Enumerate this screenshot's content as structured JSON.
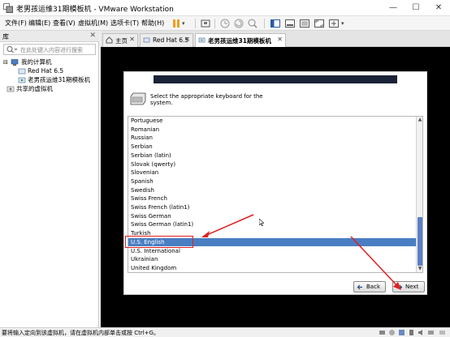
{
  "window": {
    "title": "老男孩运维31期模板机 - VMware Workstation",
    "minimize": "—",
    "maximize": "☐",
    "close": "✕",
    "accent": "#4a7ec3"
  },
  "menu": {
    "file": "文件(F)",
    "edit": "编辑(E)",
    "view": "查看(V)",
    "vm": "虚拟机(M)",
    "tabs": "选项卡(T)",
    "help": "帮助(H)"
  },
  "library": {
    "title": "库",
    "close": "✕",
    "search_placeholder": "在此处键入内容进行搜索",
    "my_computer": "我的计算机",
    "vm1": "Red Hat 6.5",
    "vm2": "老男孩运维31期模板机",
    "shared": "共享的虚拟机"
  },
  "tabs": {
    "home": "主页",
    "redhat": "Red Hat 6.5",
    "active": "老男孩运维31期模板机"
  },
  "installer": {
    "prompt": "Select the appropriate keyboard for the system.",
    "layouts": [
      "Portuguese",
      "Romanian",
      "Russian",
      "Serbian",
      "Serbian (latin)",
      "Slovak (qwerty)",
      "Slovenian",
      "Spanish",
      "Swedish",
      "Swiss French",
      "Swiss French (latin1)",
      "Swiss German",
      "Swiss German (latin1)",
      "Turkish",
      "U.S. English",
      "U.S. International",
      "Ukrainian",
      "United Kingdom"
    ],
    "selected_index": 14,
    "back_label": "Back",
    "next_label": "Next"
  },
  "status": {
    "message": "要将输入定向到该虚拟机，请在虚拟机内部单击或按 Ctrl+G。"
  }
}
